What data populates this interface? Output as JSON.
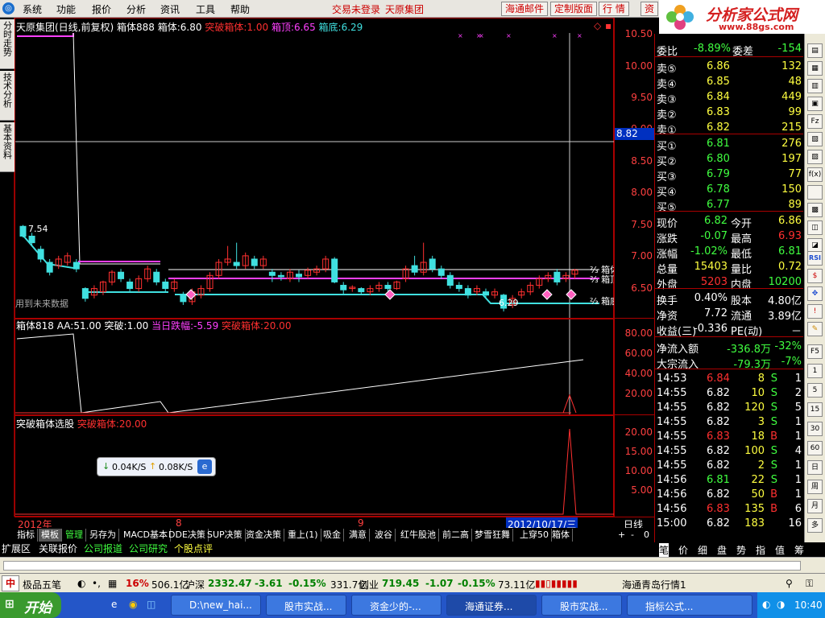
{
  "menu": {
    "items": [
      "系统",
      "功能",
      "报价",
      "分析",
      "资讯",
      "工具",
      "帮助"
    ],
    "login_status": "交易未登录",
    "company": "天原集团",
    "toolbar": [
      "海通邮件",
      "定制版面",
      "行 情",
      "资"
    ]
  },
  "brand": {
    "title": "分析家公式网",
    "url": "www.88gs.com"
  },
  "left_tabs": [
    "分时走势",
    "技术分析",
    "基本资料"
  ],
  "main_chart": {
    "header": {
      "name": "天原集团(日线,前复权)",
      "box": "箱体888",
      "box_label": "箱体:",
      "box_value": "6.80",
      "break_label": "突破箱体:",
      "break_value": "1.00",
      "top_label": "箱顶:",
      "top_value": "6.65",
      "bottom_label": "箱底:",
      "bottom_value": "6.29"
    },
    "yticks": [
      "10.50",
      "10.00",
      "9.50",
      "9.00",
      "8.50",
      "8.00",
      "7.50",
      "7.00",
      "6.50"
    ],
    "cursor_price": "8.82",
    "label_754": "7.54",
    "label_629": "6.29",
    "future_note": "用到未来数据",
    "right_labels": [
      "箱体",
      "箱顶",
      "箱底"
    ]
  },
  "panel2": {
    "header": {
      "name": "箱体818",
      "aa_label": "AA:",
      "aa": "51.00",
      "break_label": "突破:",
      "break": "1.00",
      "drop_label": "当日跌幅:",
      "drop": "-5.59",
      "box_label": "突破箱体:",
      "box": "20.00"
    },
    "yticks": [
      "80.00",
      "60.00",
      "40.00",
      "20.00"
    ]
  },
  "panel3": {
    "header": {
      "name": "突破箱体选股",
      "box_label": "突破箱体:",
      "box": "20.00"
    },
    "yticks": [
      "20.00",
      "15.00",
      "10.00",
      "5.00"
    ]
  },
  "xaxis": {
    "labels": [
      "2012年",
      "8",
      "9"
    ],
    "cursor_date": "2012/10/17/三",
    "period": "日线"
  },
  "tooltip": {
    "down": "0.04K/S",
    "up": "0.08K/S"
  },
  "chart_data": {
    "type": "candlestick",
    "ylim": [
      6.3,
      10.6
    ],
    "box": {
      "top": 6.65,
      "bottom": 6.29,
      "value": 6.8
    },
    "candles": [
      [
        7.55,
        7.4,
        7.57,
        7.38
      ],
      [
        7.4,
        7.3,
        7.45,
        7.25
      ],
      [
        7.2,
        7.05,
        7.25,
        7.0
      ],
      [
        7.0,
        6.85,
        7.05,
        6.8
      ],
      [
        6.95,
        7.05,
        7.1,
        6.9
      ],
      [
        7.0,
        7.1,
        7.15,
        6.95
      ],
      [
        7.0,
        6.9,
        7.05,
        6.85
      ],
      [
        6.6,
        6.45,
        6.62,
        6.4
      ],
      [
        6.5,
        6.6,
        6.65,
        6.45
      ],
      [
        6.55,
        6.7,
        6.72,
        6.5
      ],
      [
        6.7,
        6.85,
        6.88,
        6.65
      ],
      [
        6.85,
        6.75,
        6.9,
        6.7
      ],
      [
        6.7,
        6.6,
        6.75,
        6.55
      ],
      [
        6.6,
        6.75,
        6.8,
        6.55
      ],
      [
        6.75,
        6.9,
        6.95,
        6.7
      ],
      [
        6.85,
        6.7,
        6.9,
        6.65
      ],
      [
        6.7,
        6.6,
        6.75,
        6.55
      ],
      [
        6.6,
        6.7,
        6.75,
        6.55
      ],
      [
        6.5,
        6.4,
        6.55,
        6.35
      ],
      [
        6.4,
        6.55,
        6.6,
        6.35
      ],
      [
        6.5,
        6.6,
        6.65,
        6.45
      ],
      [
        6.6,
        6.8,
        6.85,
        6.55
      ],
      [
        6.8,
        7.0,
        7.05,
        6.75
      ],
      [
        7.0,
        7.05,
        7.25,
        6.95
      ],
      [
        7.0,
        6.95,
        7.3,
        6.9
      ],
      [
        6.95,
        7.1,
        7.15,
        6.9
      ],
      [
        7.05,
        6.95,
        7.1,
        6.9
      ],
      [
        6.95,
        7.05,
        7.1,
        6.9
      ],
      [
        6.85,
        6.8,
        6.9,
        6.7
      ],
      [
        6.8,
        6.78,
        6.85,
        6.72
      ],
      [
        6.75,
        6.85,
        6.9,
        6.7
      ],
      [
        6.82,
        6.78,
        6.88,
        6.7
      ],
      [
        6.8,
        6.88,
        6.92,
        6.75
      ],
      [
        6.85,
        6.9,
        6.95,
        6.8
      ],
      [
        6.9,
        7.05,
        7.1,
        6.85
      ],
      [
        7.05,
        6.7,
        7.08,
        6.68
      ],
      [
        6.65,
        6.58,
        6.7,
        6.5
      ],
      [
        6.6,
        6.62,
        6.65,
        6.55
      ],
      [
        6.6,
        6.55,
        6.62,
        6.5
      ],
      [
        6.55,
        6.6,
        6.65,
        6.5
      ],
      [
        6.6,
        6.65,
        6.7,
        6.55
      ],
      [
        6.65,
        6.6,
        6.7,
        6.55
      ],
      [
        6.6,
        6.7,
        6.72,
        6.58
      ],
      [
        6.75,
        6.9,
        6.95,
        6.7
      ],
      [
        6.95,
        6.85,
        7.1,
        6.8
      ],
      [
        6.85,
        7.0,
        7.3,
        6.8
      ],
      [
        7.05,
        6.9,
        7.1,
        6.85
      ],
      [
        6.9,
        6.8,
        6.95,
        6.75
      ],
      [
        6.8,
        6.65,
        6.85,
        6.6
      ],
      [
        6.65,
        6.6,
        6.7,
        6.55
      ],
      [
        6.6,
        6.5,
        6.65,
        6.45
      ],
      [
        6.55,
        6.6,
        6.65,
        6.5
      ],
      [
        6.55,
        6.5,
        6.6,
        6.45
      ],
      [
        6.5,
        6.55,
        6.6,
        6.45
      ],
      [
        6.5,
        6.3,
        6.52,
        6.25
      ],
      [
        6.35,
        6.45,
        6.5,
        6.3
      ],
      [
        6.5,
        6.55,
        6.6,
        6.45
      ],
      [
        6.55,
        6.65,
        6.7,
        6.5
      ],
      [
        6.65,
        6.75,
        6.8,
        6.6
      ],
      [
        6.75,
        6.8,
        6.85,
        6.7
      ],
      [
        6.85,
        6.7,
        6.9,
        6.65
      ],
      [
        6.75,
        6.8,
        6.85,
        6.7
      ],
      [
        6.82,
        6.88,
        6.9,
        6.75
      ]
    ]
  },
  "quote": {
    "ratio": {
      "l": "委比",
      "v": "-8.89%",
      "l2": "委差",
      "v2": "-154"
    },
    "sell": [
      {
        "l": "卖⑤",
        "p": "6.86",
        "q": "132"
      },
      {
        "l": "卖④",
        "p": "6.85",
        "q": "48"
      },
      {
        "l": "卖③",
        "p": "6.84",
        "q": "449"
      },
      {
        "l": "卖②",
        "p": "6.83",
        "q": "99"
      },
      {
        "l": "卖①",
        "p": "6.82",
        "q": "215"
      }
    ],
    "buy": [
      {
        "l": "买①",
        "p": "6.81",
        "q": "276"
      },
      {
        "l": "买②",
        "p": "6.80",
        "q": "197"
      },
      {
        "l": "买③",
        "p": "6.79",
        "q": "77"
      },
      {
        "l": "买④",
        "p": "6.78",
        "q": "150"
      },
      {
        "l": "买⑤",
        "p": "6.77",
        "q": "89"
      }
    ],
    "stats": [
      {
        "l1": "现价",
        "v1": "6.82",
        "l2": "今开",
        "v2": "6.86"
      },
      {
        "l1": "涨跌",
        "v1": "-0.07",
        "l2": "最高",
        "v2": "6.93"
      },
      {
        "l1": "涨幅",
        "v1": "-1.02%",
        "l2": "最低",
        "v2": "6.81"
      },
      {
        "l1": "总量",
        "v1": "15403",
        "l2": "量比",
        "v2": "0.72"
      },
      {
        "l1": "外盘",
        "v1": "5203",
        "l2": "内盘",
        "v2": "10200"
      }
    ],
    "stats2": [
      {
        "l1": "换手",
        "v1": "0.40%",
        "l2": "股本",
        "v2": "4.80亿"
      },
      {
        "l1": "净资",
        "v1": "7.72",
        "l2": "流通",
        "v2": "3.89亿"
      },
      {
        "l1": "收益(三)",
        "v1": "-0.336",
        "l2": "PE(动)",
        "v2": "－"
      }
    ],
    "flow": [
      {
        "l": "净流入额",
        "v": "-336.8万",
        "p": "-32%"
      },
      {
        "l": "大宗流入",
        "v": "-79.3万",
        "p": "-7%"
      }
    ],
    "ticks": [
      {
        "t": "14:53",
        "p": "6.84",
        "q": "8",
        "s": "S",
        "n": "1"
      },
      {
        "t": "14:55",
        "p": "6.82",
        "q": "10",
        "s": "S",
        "n": "2"
      },
      {
        "t": "14:55",
        "p": "6.82",
        "q": "120",
        "s": "S",
        "n": "5"
      },
      {
        "t": "14:55",
        "p": "6.82",
        "q": "3",
        "s": "S",
        "n": "1"
      },
      {
        "t": "14:55",
        "p": "6.83",
        "q": "18",
        "s": "B",
        "n": "1"
      },
      {
        "t": "14:55",
        "p": "6.82",
        "q": "100",
        "s": "S",
        "n": "4"
      },
      {
        "t": "14:55",
        "p": "6.82",
        "q": "2",
        "s": "S",
        "n": "1"
      },
      {
        "t": "14:56",
        "p": "6.81",
        "q": "22",
        "s": "S",
        "n": "1"
      },
      {
        "t": "14:56",
        "p": "6.82",
        "q": "50",
        "s": "B",
        "n": "1"
      },
      {
        "t": "14:56",
        "p": "6.83",
        "q": "135",
        "s": "B",
        "n": "6"
      },
      {
        "t": "15:00",
        "p": "6.82",
        "q": "183",
        "s": "",
        "n": "16"
      }
    ]
  },
  "bottom_tabs": [
    "指标",
    "模板",
    "管理",
    "另存为",
    "MACD基本",
    "DDE决策",
    "SUP决策",
    "资金决策",
    "重上(1)",
    "吸金",
    "满意",
    "波谷",
    "红牛股池",
    "前二高",
    "梦雪狂舞",
    "上穿50",
    "箱体",
    "+",
    "-",
    "0"
  ],
  "ext_tabs": [
    "扩展区",
    "关联报价",
    "公司报道",
    "公司研究",
    "个股点评"
  ],
  "quote_tabs": [
    "笔",
    "价",
    "细",
    "盘",
    "势",
    "指",
    "值",
    "筹"
  ],
  "status": {
    "ime": "极品五笔",
    "idx1_pct": "16%",
    "idx1_amt": "506.1亿",
    "idx2_name": "沪深",
    "idx2_val": "2332.47",
    "idx2_chg": "-3.61",
    "idx2_pct": "-0.15%",
    "idx2_amt": "331.7亿",
    "idx3_name": "创业",
    "idx3_val": "719.45",
    "idx3_chg": "-1.07",
    "idx3_pct": "-0.15%",
    "idx3_amt": "73.11亿",
    "feed": "海通青岛行情1"
  },
  "taskbar": {
    "start": "开始",
    "tasks": [
      "D:\\new_hai...",
      "股市实战...",
      "资金少的-...",
      "海通证券...",
      "股市实战...",
      "指标公式..."
    ],
    "clock": "10:40"
  },
  "right_tools": [
    "RSI",
    "Fio",
    "Fz",
    "f(x)"
  ]
}
